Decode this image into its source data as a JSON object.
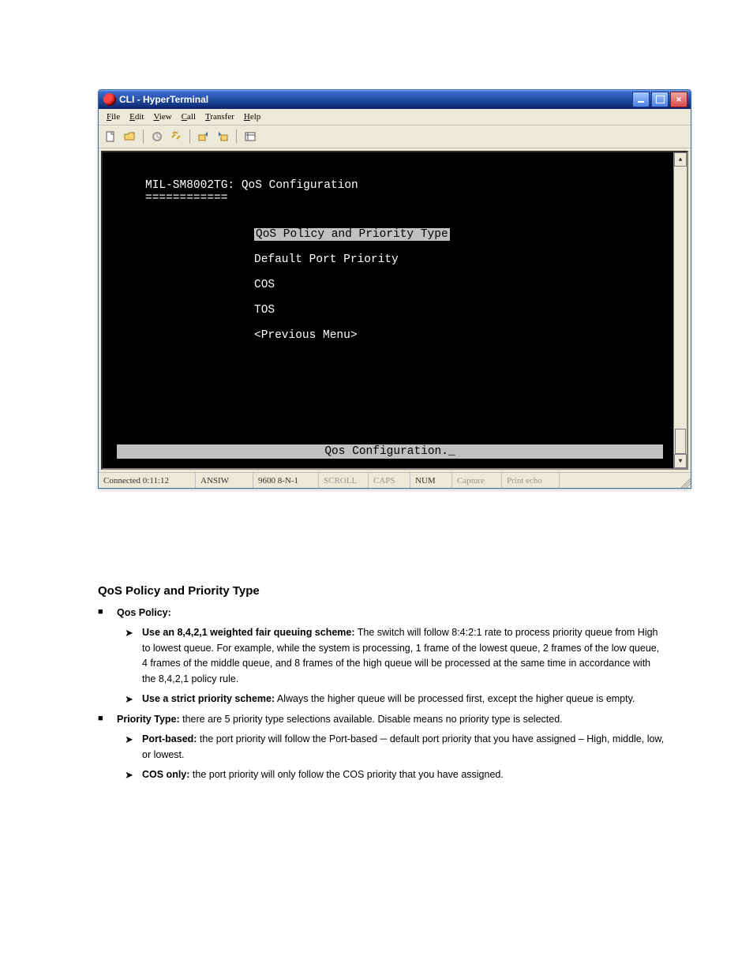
{
  "window": {
    "title": "CLI - HyperTerminal",
    "menu": {
      "file": "File",
      "edit": "Edit",
      "view": "View",
      "call": "Call",
      "transfer": "Transfer",
      "help": "Help"
    }
  },
  "terminal": {
    "header": "MIL-SM8002TG: QoS Configuration",
    "underline": "============",
    "items": [
      "QoS Policy and Priority Type",
      "Default Port Priority",
      "COS",
      "TOS",
      "<Previous Menu>"
    ],
    "bottom": "Qos Configuration._"
  },
  "status": {
    "conn": "Connected 0:11:12",
    "emul": "ANSIW",
    "baud": "9600 8-N-1",
    "scroll": "SCROLL",
    "caps": "CAPS",
    "num": "NUM",
    "capture": "Capture",
    "echo": "Print echo"
  },
  "body": {
    "heading": "QoS Policy and Priority Type",
    "b1": "Qos Policy:",
    "b1a_label": "Use an 8,4,2,1 weighted fair queuing scheme:",
    "b1a_text": " The switch will follow 8:4:2:1 rate to process priority queue from High to lowest queue. For example, while the system is processing, 1 frame of the lowest queue, 2 frames of the low queue, 4 frames of the middle queue, and 8 frames of the high queue will be processed at the same time in accordance with the 8,4,2,1 policy rule.",
    "b1b_label": "Use a strict priority scheme:",
    "b1b_text": " Always the higher queue will be processed first, except the higher queue is empty.",
    "b2": "Priority Type:",
    "b2_intro": " there are 5 priority type selections available. Disable means no priority type is selected.",
    "b2a_label": "Port-based:",
    "b2a_text": " the port priority will follow the Port-based ─ default port priority that you have assigned – High, middle, low, or lowest.",
    "b2b_label": "COS only:",
    "b2b_text": " the port priority will only follow the COS priority that you have assigned."
  }
}
